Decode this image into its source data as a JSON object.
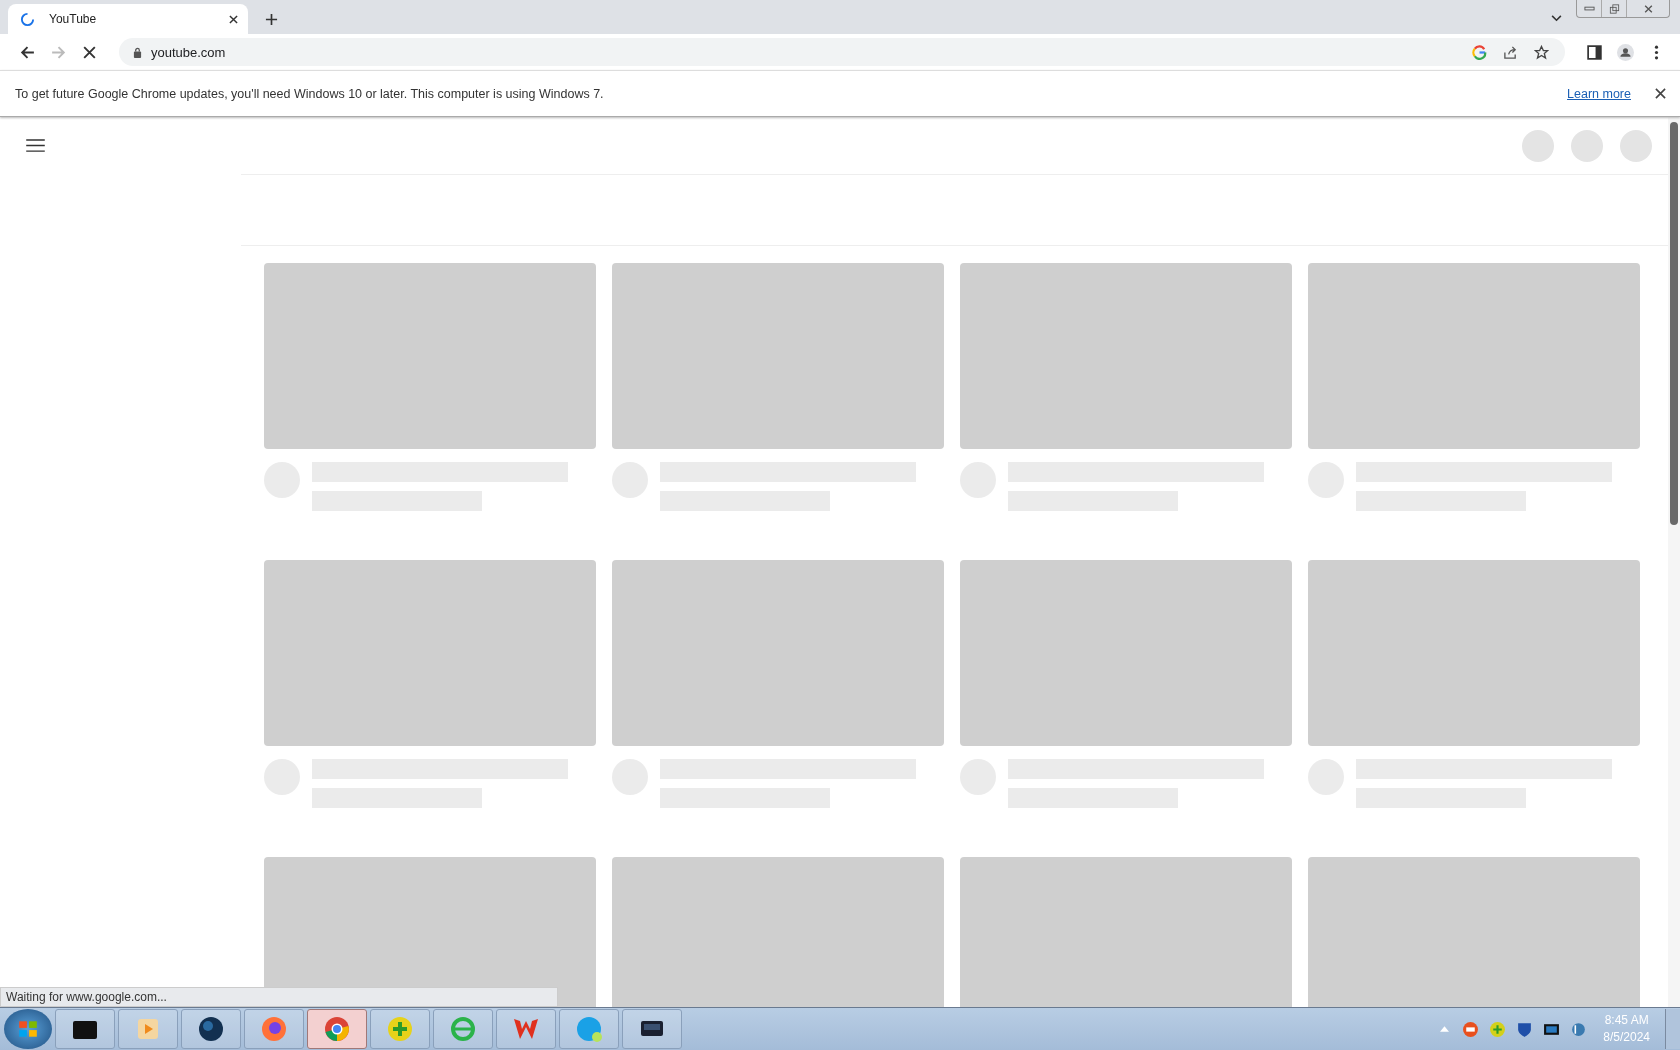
{
  "tab": {
    "title": "YouTube",
    "loading": true
  },
  "address_bar": {
    "url": "youtube.com"
  },
  "infobar": {
    "message": "To get future Google Chrome updates, you'll need Windows 10 or later. This computer is using Windows 7.",
    "link": "Learn more"
  },
  "status_bubble": "Waiting for www.google.com...",
  "taskbar": {
    "apps": [
      {
        "kind": "folder",
        "selected": false
      },
      {
        "kind": "media",
        "selected": false
      },
      {
        "kind": "globe",
        "selected": false
      },
      {
        "kind": "firefox",
        "selected": false
      },
      {
        "kind": "chrome",
        "selected": true
      },
      {
        "kind": "plus",
        "selected": false
      },
      {
        "kind": "ie",
        "selected": false
      },
      {
        "kind": "office",
        "selected": false
      },
      {
        "kind": "skype",
        "selected": false
      },
      {
        "kind": "monitor",
        "selected": false
      }
    ],
    "tray": [
      {
        "kind": "red"
      },
      {
        "kind": "plus"
      },
      {
        "kind": "shield"
      },
      {
        "kind": "screen"
      },
      {
        "kind": "network"
      }
    ],
    "time": "8:45 AM",
    "date": "8/5/2024"
  }
}
